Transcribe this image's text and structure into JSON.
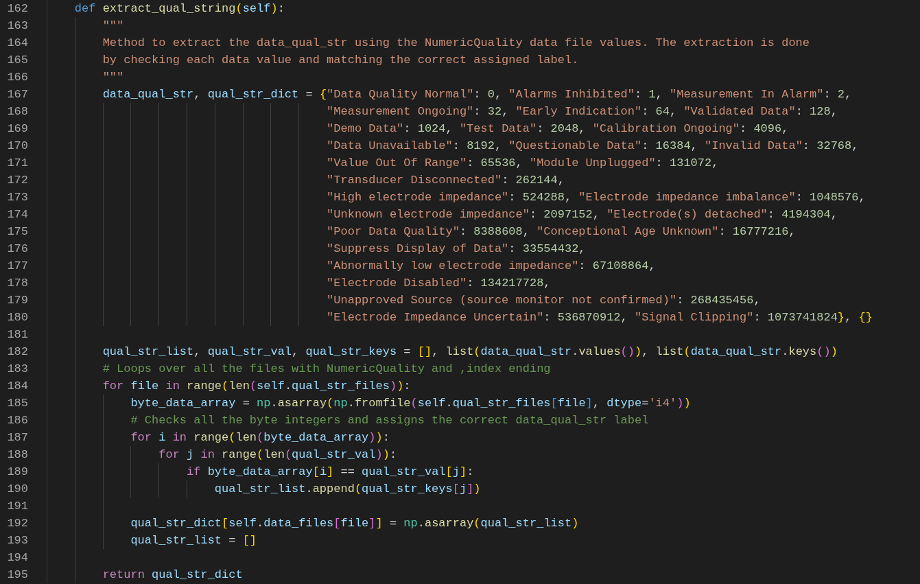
{
  "editor": {
    "lines": [
      {
        "number": "162",
        "tokens": [
          {
            "kind": "kw",
            "text": "    def "
          },
          {
            "kind": "fn",
            "text": "extract_qual_string"
          },
          {
            "kind": "b1",
            "text": "("
          },
          {
            "kind": "var",
            "text": "self"
          },
          {
            "kind": "b1",
            "text": ")"
          },
          {
            "kind": "p",
            "text": ":"
          }
        ]
      },
      {
        "number": "163",
        "tokens": [
          {
            "kind": "str",
            "text": "        \"\"\""
          }
        ]
      },
      {
        "number": "164",
        "tokens": [
          {
            "kind": "str",
            "text": "        Method to extract the data_qual_str using the NumericQuality data file values. The extraction is done"
          }
        ]
      },
      {
        "number": "165",
        "tokens": [
          {
            "kind": "str",
            "text": "        by checking each data value and matching the correct assigned label."
          }
        ]
      },
      {
        "number": "166",
        "tokens": [
          {
            "kind": "str",
            "text": "        \"\"\""
          }
        ]
      },
      {
        "number": "167",
        "tokens": [
          {
            "kind": "var",
            "text": "        data_qual_str"
          },
          {
            "kind": "p",
            "text": ", "
          },
          {
            "kind": "var",
            "text": "qual_str_dict"
          },
          {
            "kind": "p",
            "text": " = "
          },
          {
            "kind": "b1",
            "text": "{"
          },
          {
            "kind": "str",
            "text": "\"Data Quality Normal\""
          },
          {
            "kind": "p",
            "text": ": "
          },
          {
            "kind": "num",
            "text": "0"
          },
          {
            "kind": "p",
            "text": ", "
          },
          {
            "kind": "str",
            "text": "\"Alarms Inhibited\""
          },
          {
            "kind": "p",
            "text": ": "
          },
          {
            "kind": "num",
            "text": "1"
          },
          {
            "kind": "p",
            "text": ", "
          },
          {
            "kind": "str",
            "text": "\"Measurement In Alarm\""
          },
          {
            "kind": "p",
            "text": ": "
          },
          {
            "kind": "num",
            "text": "2"
          },
          {
            "kind": "p",
            "text": ","
          }
        ]
      },
      {
        "number": "168",
        "tokens": [
          {
            "kind": "str",
            "text": "                                        \"Measurement Ongoing\""
          },
          {
            "kind": "p",
            "text": ": "
          },
          {
            "kind": "num",
            "text": "32"
          },
          {
            "kind": "p",
            "text": ", "
          },
          {
            "kind": "str",
            "text": "\"Early Indication\""
          },
          {
            "kind": "p",
            "text": ": "
          },
          {
            "kind": "num",
            "text": "64"
          },
          {
            "kind": "p",
            "text": ", "
          },
          {
            "kind": "str",
            "text": "\"Validated Data\""
          },
          {
            "kind": "p",
            "text": ": "
          },
          {
            "kind": "num",
            "text": "128"
          },
          {
            "kind": "p",
            "text": ","
          }
        ]
      },
      {
        "number": "169",
        "tokens": [
          {
            "kind": "str",
            "text": "                                        \"Demo Data\""
          },
          {
            "kind": "p",
            "text": ": "
          },
          {
            "kind": "num",
            "text": "1024"
          },
          {
            "kind": "p",
            "text": ", "
          },
          {
            "kind": "str",
            "text": "\"Test Data\""
          },
          {
            "kind": "p",
            "text": ": "
          },
          {
            "kind": "num",
            "text": "2048"
          },
          {
            "kind": "p",
            "text": ", "
          },
          {
            "kind": "str",
            "text": "\"Calibration Ongoing\""
          },
          {
            "kind": "p",
            "text": ": "
          },
          {
            "kind": "num",
            "text": "4096"
          },
          {
            "kind": "p",
            "text": ","
          }
        ]
      },
      {
        "number": "170",
        "tokens": [
          {
            "kind": "str",
            "text": "                                        \"Data Unavailable\""
          },
          {
            "kind": "p",
            "text": ": "
          },
          {
            "kind": "num",
            "text": "8192"
          },
          {
            "kind": "p",
            "text": ", "
          },
          {
            "kind": "str",
            "text": "\"Questionable Data\""
          },
          {
            "kind": "p",
            "text": ": "
          },
          {
            "kind": "num",
            "text": "16384"
          },
          {
            "kind": "p",
            "text": ", "
          },
          {
            "kind": "str",
            "text": "\"Invalid Data\""
          },
          {
            "kind": "p",
            "text": ": "
          },
          {
            "kind": "num",
            "text": "32768"
          },
          {
            "kind": "p",
            "text": ","
          }
        ]
      },
      {
        "number": "171",
        "tokens": [
          {
            "kind": "str",
            "text": "                                        \"Value Out Of Range\""
          },
          {
            "kind": "p",
            "text": ": "
          },
          {
            "kind": "num",
            "text": "65536"
          },
          {
            "kind": "p",
            "text": ", "
          },
          {
            "kind": "str",
            "text": "\"Module Unplugged\""
          },
          {
            "kind": "p",
            "text": ": "
          },
          {
            "kind": "num",
            "text": "131072"
          },
          {
            "kind": "p",
            "text": ","
          }
        ]
      },
      {
        "number": "172",
        "tokens": [
          {
            "kind": "str",
            "text": "                                        \"Transducer Disconnected\""
          },
          {
            "kind": "p",
            "text": ": "
          },
          {
            "kind": "num",
            "text": "262144"
          },
          {
            "kind": "p",
            "text": ","
          }
        ]
      },
      {
        "number": "173",
        "tokens": [
          {
            "kind": "str",
            "text": "                                        \"High electrode impedance\""
          },
          {
            "kind": "p",
            "text": ": "
          },
          {
            "kind": "num",
            "text": "524288"
          },
          {
            "kind": "p",
            "text": ", "
          },
          {
            "kind": "str",
            "text": "\"Electrode impedance imbalance\""
          },
          {
            "kind": "p",
            "text": ": "
          },
          {
            "kind": "num",
            "text": "1048576"
          },
          {
            "kind": "p",
            "text": ","
          }
        ]
      },
      {
        "number": "174",
        "tokens": [
          {
            "kind": "str",
            "text": "                                        \"Unknown electrode impedance\""
          },
          {
            "kind": "p",
            "text": ": "
          },
          {
            "kind": "num",
            "text": "2097152"
          },
          {
            "kind": "p",
            "text": ", "
          },
          {
            "kind": "str",
            "text": "\"Electrode(s) detached\""
          },
          {
            "kind": "p",
            "text": ": "
          },
          {
            "kind": "num",
            "text": "4194304"
          },
          {
            "kind": "p",
            "text": ","
          }
        ]
      },
      {
        "number": "175",
        "tokens": [
          {
            "kind": "str",
            "text": "                                        \"Poor Data Quality\""
          },
          {
            "kind": "p",
            "text": ": "
          },
          {
            "kind": "num",
            "text": "8388608"
          },
          {
            "kind": "p",
            "text": ", "
          },
          {
            "kind": "str",
            "text": "\"Conceptional Age Unknown\""
          },
          {
            "kind": "p",
            "text": ": "
          },
          {
            "kind": "num",
            "text": "16777216"
          },
          {
            "kind": "p",
            "text": ","
          }
        ]
      },
      {
        "number": "176",
        "tokens": [
          {
            "kind": "str",
            "text": "                                        \"Suppress Display of Data\""
          },
          {
            "kind": "p",
            "text": ": "
          },
          {
            "kind": "num",
            "text": "33554432"
          },
          {
            "kind": "p",
            "text": ","
          }
        ]
      },
      {
        "number": "177",
        "tokens": [
          {
            "kind": "str",
            "text": "                                        \"Abnormally low electrode impedance\""
          },
          {
            "kind": "p",
            "text": ": "
          },
          {
            "kind": "num",
            "text": "67108864"
          },
          {
            "kind": "p",
            "text": ","
          }
        ]
      },
      {
        "number": "178",
        "tokens": [
          {
            "kind": "str",
            "text": "                                        \"Electrode Disabled\""
          },
          {
            "kind": "p",
            "text": ": "
          },
          {
            "kind": "num",
            "text": "134217728"
          },
          {
            "kind": "p",
            "text": ","
          }
        ]
      },
      {
        "number": "179",
        "tokens": [
          {
            "kind": "str",
            "text": "                                        \"Unapproved Source (source monitor not confirmed)\""
          },
          {
            "kind": "p",
            "text": ": "
          },
          {
            "kind": "num",
            "text": "268435456"
          },
          {
            "kind": "p",
            "text": ","
          }
        ]
      },
      {
        "number": "180",
        "tokens": [
          {
            "kind": "str",
            "text": "                                        \"Electrode Impedance Uncertain\""
          },
          {
            "kind": "p",
            "text": ": "
          },
          {
            "kind": "num",
            "text": "536870912"
          },
          {
            "kind": "p",
            "text": ", "
          },
          {
            "kind": "str",
            "text": "\"Signal Clipping\""
          },
          {
            "kind": "p",
            "text": ": "
          },
          {
            "kind": "num",
            "text": "1073741824"
          },
          {
            "kind": "b1",
            "text": "}"
          },
          {
            "kind": "p",
            "text": ", "
          },
          {
            "kind": "b1",
            "text": "{}"
          }
        ]
      },
      {
        "number": "181"
      },
      {
        "number": "182",
        "tokens": [
          {
            "kind": "var",
            "text": "        qual_str_list"
          },
          {
            "kind": "p",
            "text": ", "
          },
          {
            "kind": "var",
            "text": "qual_str_val"
          },
          {
            "kind": "p",
            "text": ", "
          },
          {
            "kind": "var",
            "text": "qual_str_keys"
          },
          {
            "kind": "p",
            "text": " = "
          },
          {
            "kind": "b1",
            "text": "[]"
          },
          {
            "kind": "p",
            "text": ", "
          },
          {
            "kind": "fn",
            "text": "list"
          },
          {
            "kind": "b1",
            "text": "("
          },
          {
            "kind": "var",
            "text": "data_qual_str"
          },
          {
            "kind": "p",
            "text": "."
          },
          {
            "kind": "fn",
            "text": "values"
          },
          {
            "kind": "b2",
            "text": "()"
          },
          {
            "kind": "b1",
            "text": ")"
          },
          {
            "kind": "p",
            "text": ", "
          },
          {
            "kind": "fn",
            "text": "list"
          },
          {
            "kind": "b1",
            "text": "("
          },
          {
            "kind": "var",
            "text": "data_qual_str"
          },
          {
            "kind": "p",
            "text": "."
          },
          {
            "kind": "fn",
            "text": "keys"
          },
          {
            "kind": "b2",
            "text": "()"
          },
          {
            "kind": "b1",
            "text": ")"
          }
        ]
      },
      {
        "number": "183",
        "tokens": [
          {
            "kind": "cm",
            "text": "        # Loops over all the files with NumericQuality and ,index ending"
          }
        ]
      },
      {
        "number": "184",
        "tokens": [
          {
            "kind": "ctl",
            "text": "        for "
          },
          {
            "kind": "var",
            "text": "file "
          },
          {
            "kind": "ctl",
            "text": "in "
          },
          {
            "kind": "fn",
            "text": "range"
          },
          {
            "kind": "b1",
            "text": "("
          },
          {
            "kind": "fn",
            "text": "len"
          },
          {
            "kind": "b2",
            "text": "("
          },
          {
            "kind": "var",
            "text": "self"
          },
          {
            "kind": "p",
            "text": "."
          },
          {
            "kind": "var",
            "text": "qual_str_files"
          },
          {
            "kind": "b2",
            "text": ")"
          },
          {
            "kind": "b1",
            "text": ")"
          },
          {
            "kind": "p",
            "text": ":"
          }
        ]
      },
      {
        "number": "185",
        "tokens": [
          {
            "kind": "var",
            "text": "            byte_data_array"
          },
          {
            "kind": "p",
            "text": " = "
          },
          {
            "kind": "cls",
            "text": "np"
          },
          {
            "kind": "p",
            "text": "."
          },
          {
            "kind": "fn",
            "text": "asarray"
          },
          {
            "kind": "b1",
            "text": "("
          },
          {
            "kind": "cls",
            "text": "np"
          },
          {
            "kind": "p",
            "text": "."
          },
          {
            "kind": "fn",
            "text": "fromfile"
          },
          {
            "kind": "b2",
            "text": "("
          },
          {
            "kind": "var",
            "text": "self"
          },
          {
            "kind": "p",
            "text": "."
          },
          {
            "kind": "var",
            "text": "qual_str_files"
          },
          {
            "kind": "b3",
            "text": "["
          },
          {
            "kind": "var",
            "text": "file"
          },
          {
            "kind": "b3",
            "text": "]"
          },
          {
            "kind": "p",
            "text": ", "
          },
          {
            "kind": "var",
            "text": "dtype"
          },
          {
            "kind": "p",
            "text": "="
          },
          {
            "kind": "str",
            "text": "'i4'"
          },
          {
            "kind": "b2",
            "text": ")"
          },
          {
            "kind": "b1",
            "text": ")"
          }
        ]
      },
      {
        "number": "186",
        "tokens": [
          {
            "kind": "cm",
            "text": "            # Checks all the byte integers and assigns the correct data_qual_str label"
          }
        ]
      },
      {
        "number": "187",
        "tokens": [
          {
            "kind": "ctl",
            "text": "            for "
          },
          {
            "kind": "var",
            "text": "i "
          },
          {
            "kind": "ctl",
            "text": "in "
          },
          {
            "kind": "fn",
            "text": "range"
          },
          {
            "kind": "b1",
            "text": "("
          },
          {
            "kind": "fn",
            "text": "len"
          },
          {
            "kind": "b2",
            "text": "("
          },
          {
            "kind": "var",
            "text": "byte_data_array"
          },
          {
            "kind": "b2",
            "text": ")"
          },
          {
            "kind": "b1",
            "text": ")"
          },
          {
            "kind": "p",
            "text": ":"
          }
        ]
      },
      {
        "number": "188",
        "tokens": [
          {
            "kind": "ctl",
            "text": "                for "
          },
          {
            "kind": "var",
            "text": "j "
          },
          {
            "kind": "ctl",
            "text": "in "
          },
          {
            "kind": "fn",
            "text": "range"
          },
          {
            "kind": "b1",
            "text": "("
          },
          {
            "kind": "fn",
            "text": "len"
          },
          {
            "kind": "b2",
            "text": "("
          },
          {
            "kind": "var",
            "text": "qual_str_val"
          },
          {
            "kind": "b2",
            "text": ")"
          },
          {
            "kind": "b1",
            "text": ")"
          },
          {
            "kind": "p",
            "text": ":"
          }
        ]
      },
      {
        "number": "189",
        "tokens": [
          {
            "kind": "ctl",
            "text": "                    if "
          },
          {
            "kind": "var",
            "text": "byte_data_array"
          },
          {
            "kind": "b1",
            "text": "["
          },
          {
            "kind": "var",
            "text": "i"
          },
          {
            "kind": "b1",
            "text": "]"
          },
          {
            "kind": "p",
            "text": " == "
          },
          {
            "kind": "var",
            "text": "qual_str_val"
          },
          {
            "kind": "b1",
            "text": "["
          },
          {
            "kind": "var",
            "text": "j"
          },
          {
            "kind": "b1",
            "text": "]"
          },
          {
            "kind": "p",
            "text": ":"
          }
        ]
      },
      {
        "number": "190",
        "tokens": [
          {
            "kind": "var",
            "text": "                        qual_str_list"
          },
          {
            "kind": "p",
            "text": "."
          },
          {
            "kind": "fn",
            "text": "append"
          },
          {
            "kind": "b1",
            "text": "("
          },
          {
            "kind": "var",
            "text": "qual_str_keys"
          },
          {
            "kind": "b2",
            "text": "["
          },
          {
            "kind": "var",
            "text": "j"
          },
          {
            "kind": "b2",
            "text": "]"
          },
          {
            "kind": "b1",
            "text": ")"
          }
        ]
      },
      {
        "number": "191"
      },
      {
        "number": "192",
        "tokens": [
          {
            "kind": "var",
            "text": "            qual_str_dict"
          },
          {
            "kind": "b1",
            "text": "["
          },
          {
            "kind": "var",
            "text": "self"
          },
          {
            "kind": "p",
            "text": "."
          },
          {
            "kind": "var",
            "text": "data_files"
          },
          {
            "kind": "b2",
            "text": "["
          },
          {
            "kind": "var",
            "text": "file"
          },
          {
            "kind": "b2",
            "text": "]"
          },
          {
            "kind": "b1",
            "text": "]"
          },
          {
            "kind": "p",
            "text": " = "
          },
          {
            "kind": "cls",
            "text": "np"
          },
          {
            "kind": "p",
            "text": "."
          },
          {
            "kind": "fn",
            "text": "asarray"
          },
          {
            "kind": "b1",
            "text": "("
          },
          {
            "kind": "var",
            "text": "qual_str_list"
          },
          {
            "kind": "b1",
            "text": ")"
          }
        ]
      },
      {
        "number": "193",
        "tokens": [
          {
            "kind": "var",
            "text": "            qual_str_list"
          },
          {
            "kind": "p",
            "text": " = "
          },
          {
            "kind": "b1",
            "text": "[]"
          }
        ]
      },
      {
        "number": "194"
      },
      {
        "number": "195",
        "tokens": [
          {
            "kind": "ctl",
            "text": "        return "
          },
          {
            "kind": "var",
            "text": "qual_str_dict"
          }
        ]
      }
    ]
  }
}
